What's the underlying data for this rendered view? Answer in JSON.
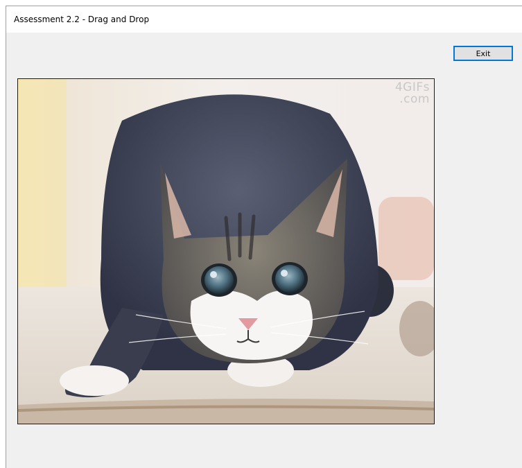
{
  "window": {
    "title": "Assessment 2.2 - Drag and Drop"
  },
  "toolbar": {
    "exit_label": "Exit"
  },
  "picture": {
    "subject": "cat-photo",
    "watermark_line1": "4GIFs",
    "watermark_line2": ".com"
  },
  "colors": {
    "window_bg": "#f0f0f0",
    "button_border": "#0078d7",
    "button_bg": "#e1e1e1"
  }
}
